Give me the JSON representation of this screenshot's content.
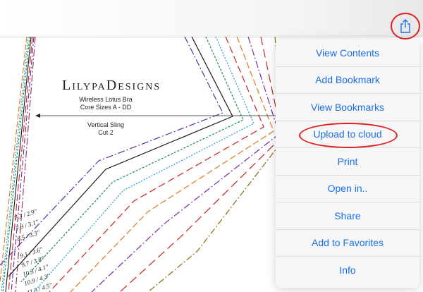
{
  "toolbar": {
    "share_icon": "share-icon"
  },
  "pattern": {
    "brand": "LilypaDesigns",
    "product": "Wireless Lotus Bra",
    "core_sizes": "Core Sizes A - DD",
    "piece_name": "Vertical Sling",
    "cut": "Cut 2",
    "size_labels": [
      "7.3 / 2.9\"",
      "7.9 / 3.1\"",
      "8.5 / 3.3\"",
      "9.1 / 3.6\"",
      "9.7 / 3.8\"",
      "10.3 / 4.1\"",
      "10.9 / 4.3\"",
      "11.5 / 4.5\""
    ]
  },
  "menu": {
    "items": [
      {
        "label": "View Contents"
      },
      {
        "label": "Add Bookmark"
      },
      {
        "label": "View Bookmarks"
      },
      {
        "label": "Upload to cloud",
        "highlighted": true
      },
      {
        "label": "Print"
      },
      {
        "label": "Open in.."
      },
      {
        "label": "Share"
      },
      {
        "label": "Add to Favorites"
      },
      {
        "label": "Info"
      }
    ]
  },
  "colors": {
    "menu_text": "#1a6fe8",
    "annotation": "#e02020"
  }
}
